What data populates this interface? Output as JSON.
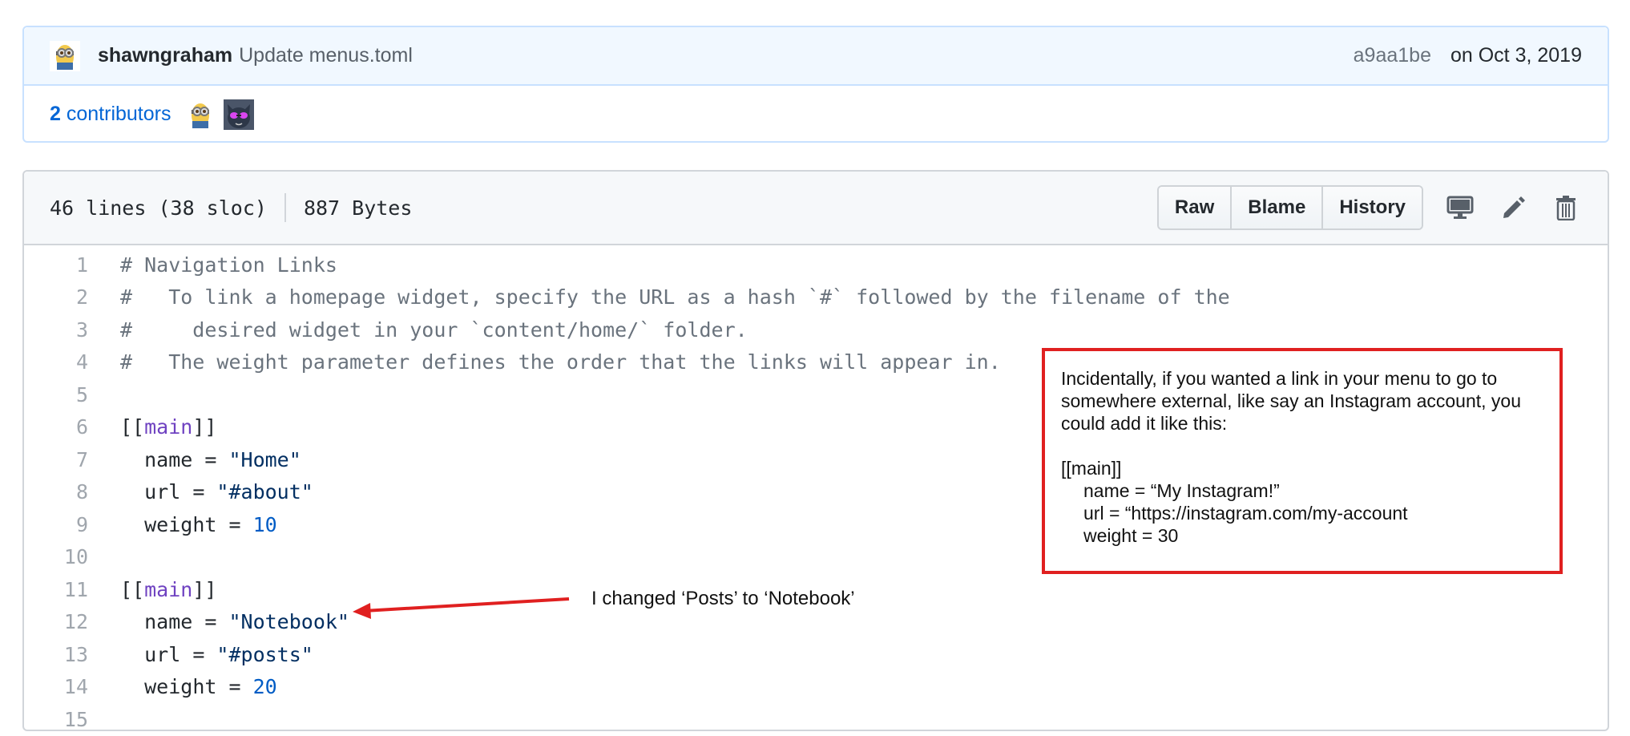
{
  "commit": {
    "author": "shawngraham",
    "message": "Update menus.toml",
    "sha": "a9aa1be",
    "date": "on Oct 3, 2019",
    "contributors_count": "2",
    "contributors_label": "contributors"
  },
  "file": {
    "lines_info": "46 lines (38 sloc)",
    "size": "887 Bytes",
    "buttons": {
      "raw": "Raw",
      "blame": "Blame",
      "history": "History"
    },
    "icons": [
      "desktop-icon",
      "pencil-icon",
      "trash-icon"
    ]
  },
  "code": [
    {
      "n": "1",
      "t": "# Navigation Links"
    },
    {
      "n": "2",
      "t": "#   To link a homepage widget, specify the URL as a hash `#` followed by the filename of the"
    },
    {
      "n": "3",
      "t": "#     desired widget in your `content/home/` folder."
    },
    {
      "n": "4",
      "t": "#   The weight parameter defines the order that the links will appear in."
    },
    {
      "n": "5",
      "t": ""
    },
    {
      "n": "6",
      "t": "[[main]]"
    },
    {
      "n": "7",
      "t": "  name = \"Home\""
    },
    {
      "n": "8",
      "t": "  url = \"#about\""
    },
    {
      "n": "9",
      "t": "  weight = 10"
    },
    {
      "n": "10",
      "t": ""
    },
    {
      "n": "11",
      "t": "[[main]]"
    },
    {
      "n": "12",
      "t": "  name = \"Notebook\""
    },
    {
      "n": "13",
      "t": "  url = \"#posts\""
    },
    {
      "n": "14",
      "t": "  weight = 20"
    },
    {
      "n": "15",
      "t": ""
    }
  ],
  "annotations": {
    "note_lines": [
      "Incidentally, if you wanted a link in your menu  to go to",
      "somewhere external, like say an Instagram account, you",
      "could add it like this:"
    ],
    "note_code": [
      "[[main]]",
      "name = “My Instagram!”",
      "url = “https://instagram.com/my-account",
      "weight = 30"
    ],
    "arrow_label": "I changed ‘Posts’ to ‘Notebook’"
  },
  "colors": {
    "accent_link": "#0366d6",
    "annotation_red": "#e02020",
    "comment": "#6a737d",
    "keyword": "#6f42c1",
    "string": "#032f62",
    "number": "#005cc5"
  }
}
